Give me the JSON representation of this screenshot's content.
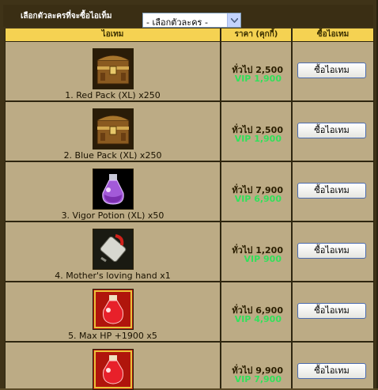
{
  "toolbar": {
    "select_label": "เลือกตัวละครที่จะซื้อไอเท็ม",
    "character_select_value": "- เลือกตัวละคร -"
  },
  "table": {
    "headers": [
      "ไอเทม",
      "ราคา (คุกกี้)",
      "ซื้อไอเทม"
    ],
    "rows": [
      {
        "name": "1. Red Pack (XL) x250",
        "normal_price": "ทั่วไป 2,500",
        "vip_price": "VIP 1,900",
        "buy_label": "ซื้อไอเทม",
        "icon": "treasure-chest-icon"
      },
      {
        "name": "2. Blue Pack (XL) x250",
        "normal_price": "ทั่วไป 2,500",
        "vip_price": "VIP 1,900",
        "buy_label": "ซื้อไอเทม",
        "icon": "treasure-chest-icon"
      },
      {
        "name": "3. Vigor Potion (XL) x50",
        "normal_price": "ทั่วไป 7,900",
        "vip_price": "VIP 6,900",
        "buy_label": "ซื้อไอเทม",
        "icon": "purple-potion-icon"
      },
      {
        "name": "4. Mother's loving hand x1",
        "normal_price": "ทั่วไป 1,200",
        "vip_price": "VIP 900",
        "buy_label": "ซื้อไอเทม",
        "icon": "scroll-icon"
      },
      {
        "name": "5. Max HP +1900 x5",
        "normal_price": "ทั่วไป 6,900",
        "vip_price": "VIP 4,900",
        "buy_label": "ซื้อไอเทม",
        "icon": "red-potion-icon"
      },
      {
        "name": "",
        "normal_price": "ทั่วไป 9,900",
        "vip_price": "VIP 7,900",
        "buy_label": "ซื้อไอเทม",
        "icon": "red-potion-icon"
      }
    ]
  },
  "colors": {
    "header_bg": "#f5d252",
    "cell_bg": "#bcab85",
    "vip_text": "#33e05a"
  }
}
